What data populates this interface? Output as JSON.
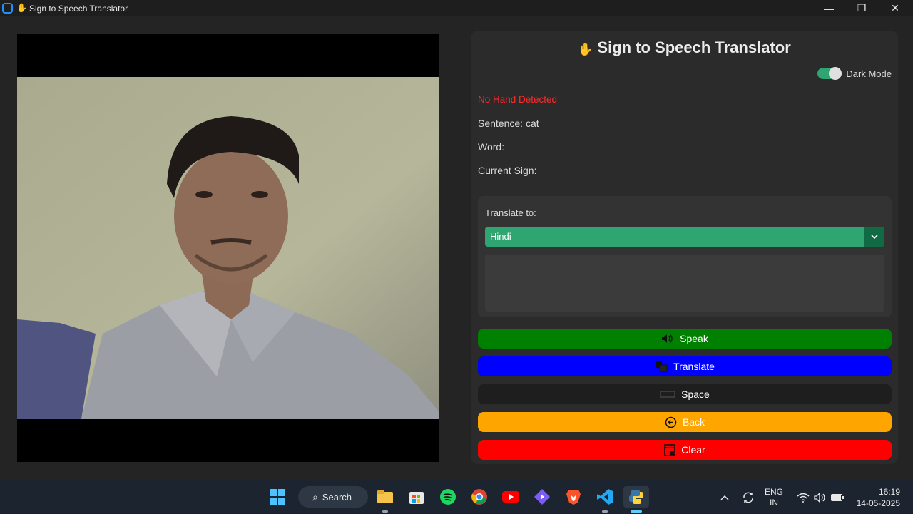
{
  "window": {
    "title": "Sign to Speech Translator",
    "controls": {
      "minimize": "—",
      "maximize": "❐",
      "close": "✕"
    }
  },
  "panel": {
    "title": "Sign to Speech Translator",
    "dark_mode": {
      "label": "Dark Mode",
      "enabled": true
    },
    "status_hand": "No Hand Detected",
    "sentence": "Sentence: cat",
    "word": "Word:",
    "current_sign": "Current Sign:",
    "translate": {
      "label": "Translate to:",
      "selected_language": "Hindi",
      "output_text": ""
    },
    "buttons": {
      "speak": "Speak",
      "translate": "Translate",
      "space": "Space",
      "back": "Back",
      "clear": "Clear"
    }
  },
  "colors": {
    "accent_green": "#2fa572",
    "speak": "#008000",
    "translate": "#0000ff",
    "space": "#1e1e1e",
    "back": "#ffa500",
    "clear": "#ff0000",
    "status_red": "#ff2a2a"
  },
  "taskbar": {
    "search_label": "Search",
    "apps": [
      "windows-start-icon",
      "file-explorer-icon",
      "store-icon",
      "spotify-icon",
      "chrome-icon",
      "youtube-icon",
      "media-player-icon",
      "brave-icon",
      "vscode-icon",
      "python-icon"
    ],
    "lang_top": "ENG",
    "lang_bottom": "IN",
    "time": "16:19",
    "date": "14-05-2025"
  }
}
